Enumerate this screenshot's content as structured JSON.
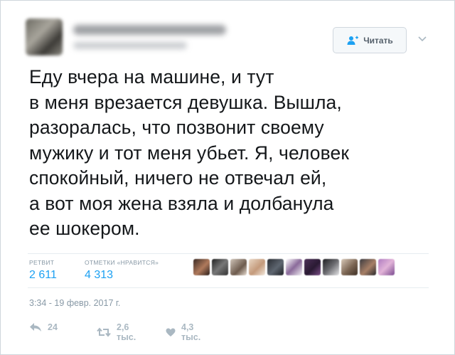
{
  "header": {
    "follow_label": "Читать"
  },
  "tweet": {
    "text": "Еду вчера на машине, и тут\nв меня врезается девушка. Вышла,\nразоралась, что позвонит своему\nмужику и тот меня убьет. Я, человек\nспокойный, ничего не отвечал ей,\nа вот моя жена взяла и долбанула\nее шокером.",
    "timestamp": "3:34 - 19 февр. 2017 г."
  },
  "stats": {
    "retweets_label": "РЕТВИТ",
    "retweets_value": "2 611",
    "likes_label": "ОТМЕТКИ «НРАВИТСЯ»",
    "likes_value": "4 313"
  },
  "actions": {
    "reply_count": "24",
    "retweet_count": "2,6 тыс.",
    "like_count": "4,3 тыс."
  },
  "colors": {
    "accent": "#1da1f2",
    "muted": "#8899a6",
    "text": "#14171a"
  }
}
